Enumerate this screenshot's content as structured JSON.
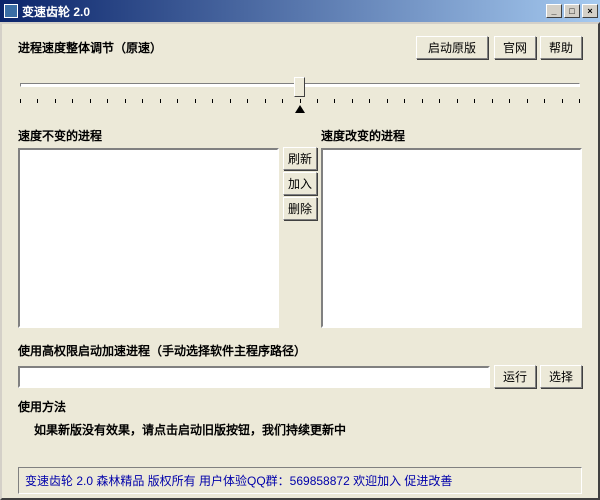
{
  "window": {
    "title": "变速齿轮 2.0"
  },
  "top": {
    "slider_label": "进程速度整体调节（原速）",
    "launch_original": "启动原版",
    "official_site": "官网",
    "help": "帮助"
  },
  "lists": {
    "unchanged_label": "速度不变的进程",
    "changed_label": "速度改变的进程",
    "refresh": "刷新",
    "add": "加入",
    "remove": "删除"
  },
  "path": {
    "label": "使用高权限启动加速进程（手动选择软件主程序路径）",
    "value": "",
    "run": "运行",
    "select": "选择"
  },
  "usage": {
    "title": "使用方法",
    "body": "如果新版没有效果，请点击启动旧版按钮，我们持续更新中"
  },
  "footer": {
    "text": "变速齿轮 2.0 森林精品 版权所有 用户体验QQ群：569858872 欢迎加入 促进改善"
  }
}
